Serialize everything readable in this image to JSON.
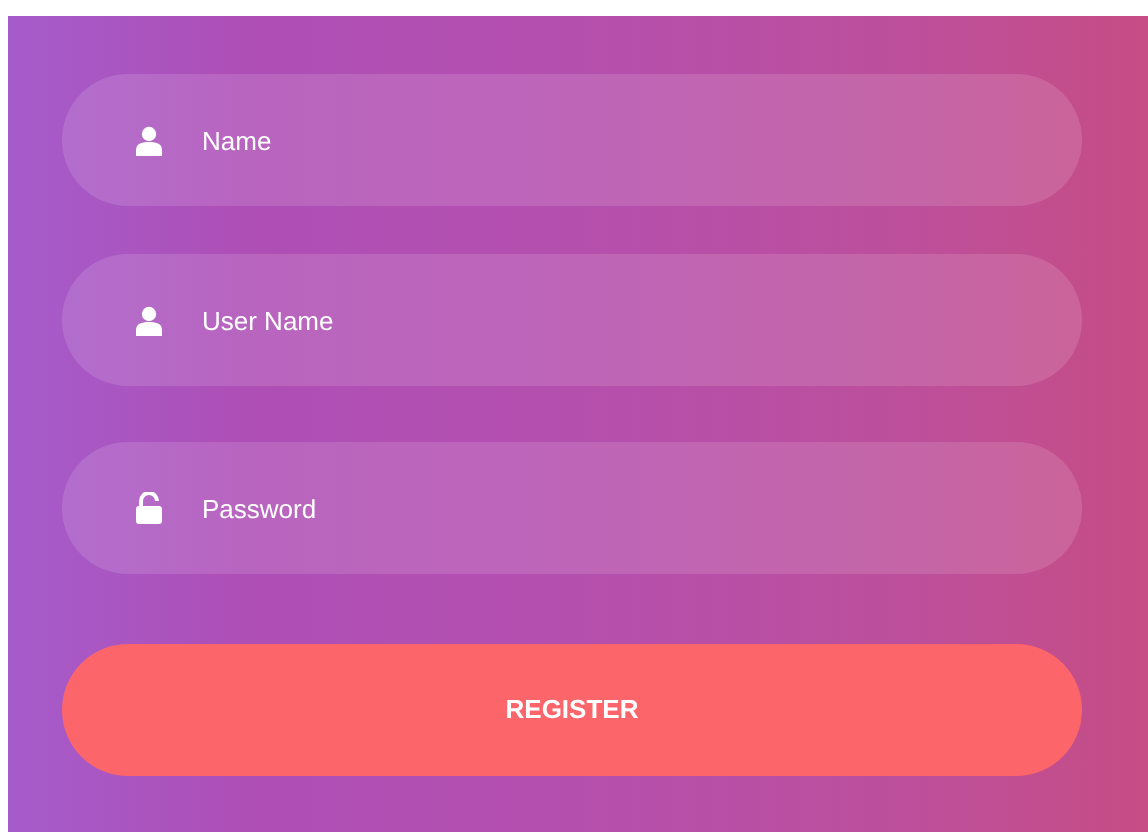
{
  "fields": [
    {
      "kind": "person",
      "placeholder": "Name"
    },
    {
      "kind": "person",
      "placeholder": "User Name"
    },
    {
      "kind": "lock",
      "placeholder": "Password"
    }
  ],
  "register_button": {
    "label": "REGISTER"
  }
}
